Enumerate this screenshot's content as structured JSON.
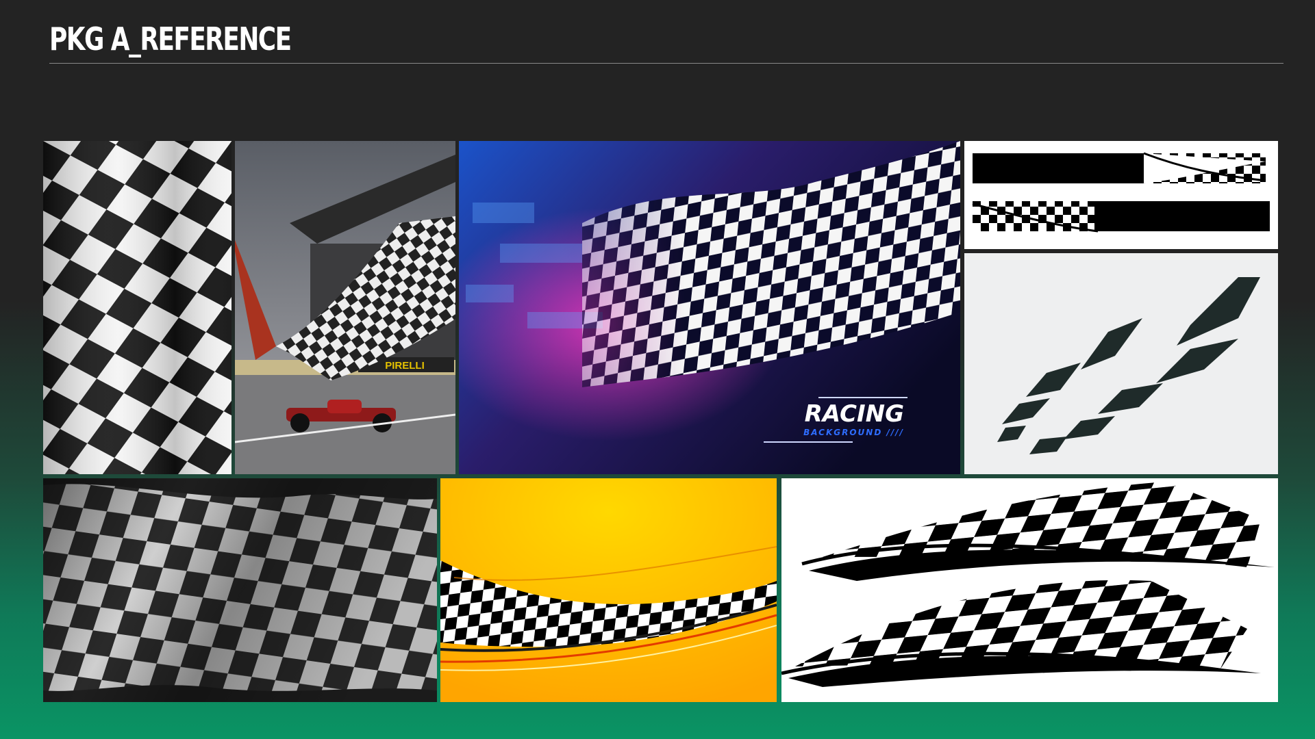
{
  "page": {
    "title": "PKG A_REFERENCE"
  },
  "images": {
    "img1": {
      "icon": "checkered-flag-closeup"
    },
    "img2": {
      "icon": "flag-waved-over-race-car",
      "banner": "PIRELLI"
    },
    "img3": {
      "icon": "racing-background",
      "headline": "RACING",
      "subline": "BACKGROUND ////"
    },
    "img4": {
      "icon": "checkered-stripe-decal"
    },
    "img5": {
      "icon": "checkered-swoosh-logo"
    },
    "img6": {
      "icon": "grey-textured-checkered-flag"
    },
    "img7": {
      "icon": "yellow-checkered-swoosh"
    },
    "img8": {
      "icon": "checkered-flag-decals"
    }
  },
  "colors": {
    "accent_green": "#0a9464",
    "background_dark": "#232323"
  }
}
